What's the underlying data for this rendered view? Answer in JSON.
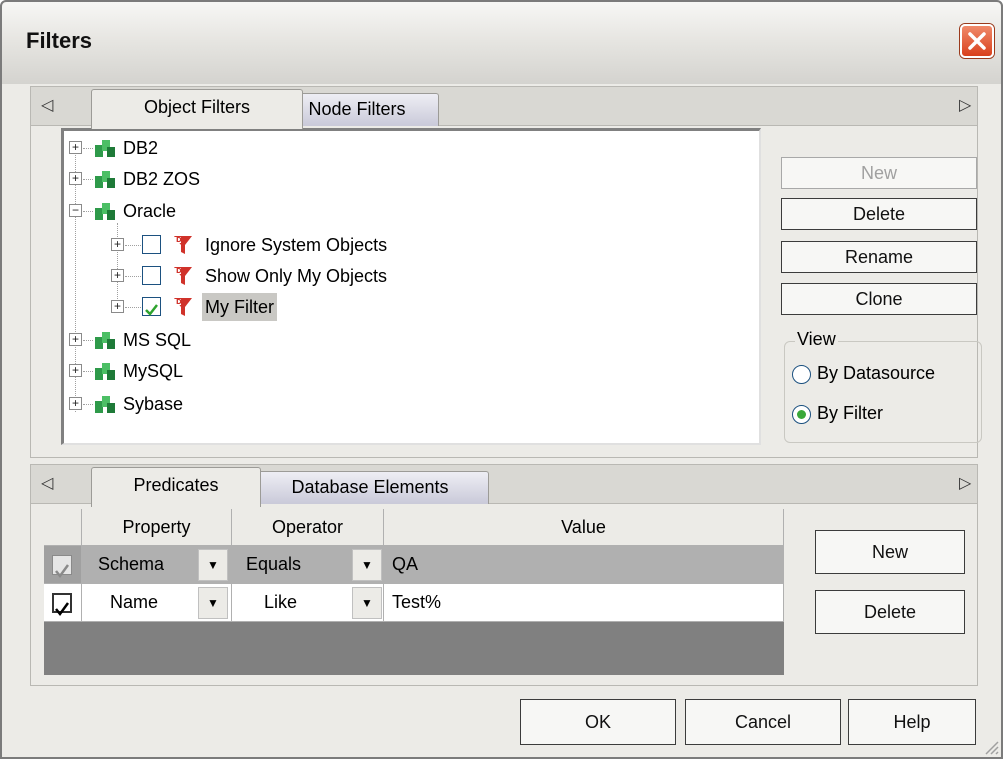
{
  "window": {
    "title": "Filters"
  },
  "top_tabs": [
    {
      "label": "Object Filters"
    },
    {
      "label": "Node Filters"
    }
  ],
  "tree": {
    "nodes": [
      {
        "label": "DB2",
        "expanded": false
      },
      {
        "label": "DB2 ZOS",
        "expanded": false
      },
      {
        "label": "Oracle",
        "expanded": true
      },
      {
        "label": "Ignore System Objects",
        "checked": false
      },
      {
        "label": "Show Only My Objects",
        "checked": false
      },
      {
        "label": "My Filter",
        "checked": true,
        "selected": true
      },
      {
        "label": "MS SQL",
        "expanded": false
      },
      {
        "label": "MySQL",
        "expanded": false
      },
      {
        "label": "Sybase",
        "expanded": false
      }
    ]
  },
  "side_buttons": {
    "new": "New",
    "delete": "Delete",
    "rename": "Rename",
    "clone": "Clone"
  },
  "view": {
    "label": "View",
    "by_datasource": "By Datasource",
    "by_filter": "By Filter",
    "selected": "by_filter"
  },
  "bottom_tabs": [
    {
      "label": "Predicates"
    },
    {
      "label": "Database Elements"
    }
  ],
  "grid": {
    "headers": {
      "property": "Property",
      "operator": "Operator",
      "value": "Value"
    },
    "rows": [
      {
        "property": "Schema",
        "operator": "Equals",
        "value": "QA",
        "checked": true
      },
      {
        "property": "Name",
        "operator": "Like",
        "value": "Test%",
        "checked": true
      }
    ]
  },
  "grid_buttons": {
    "new": "New",
    "delete": "Delete"
  },
  "footer": {
    "ok": "OK",
    "cancel": "Cancel",
    "help": "Help"
  },
  "colors": {
    "close_button": "#d9401c",
    "folder_green": "#2e9a4a",
    "filter_red": "#d0322a",
    "check_green": "#2ea32e"
  }
}
